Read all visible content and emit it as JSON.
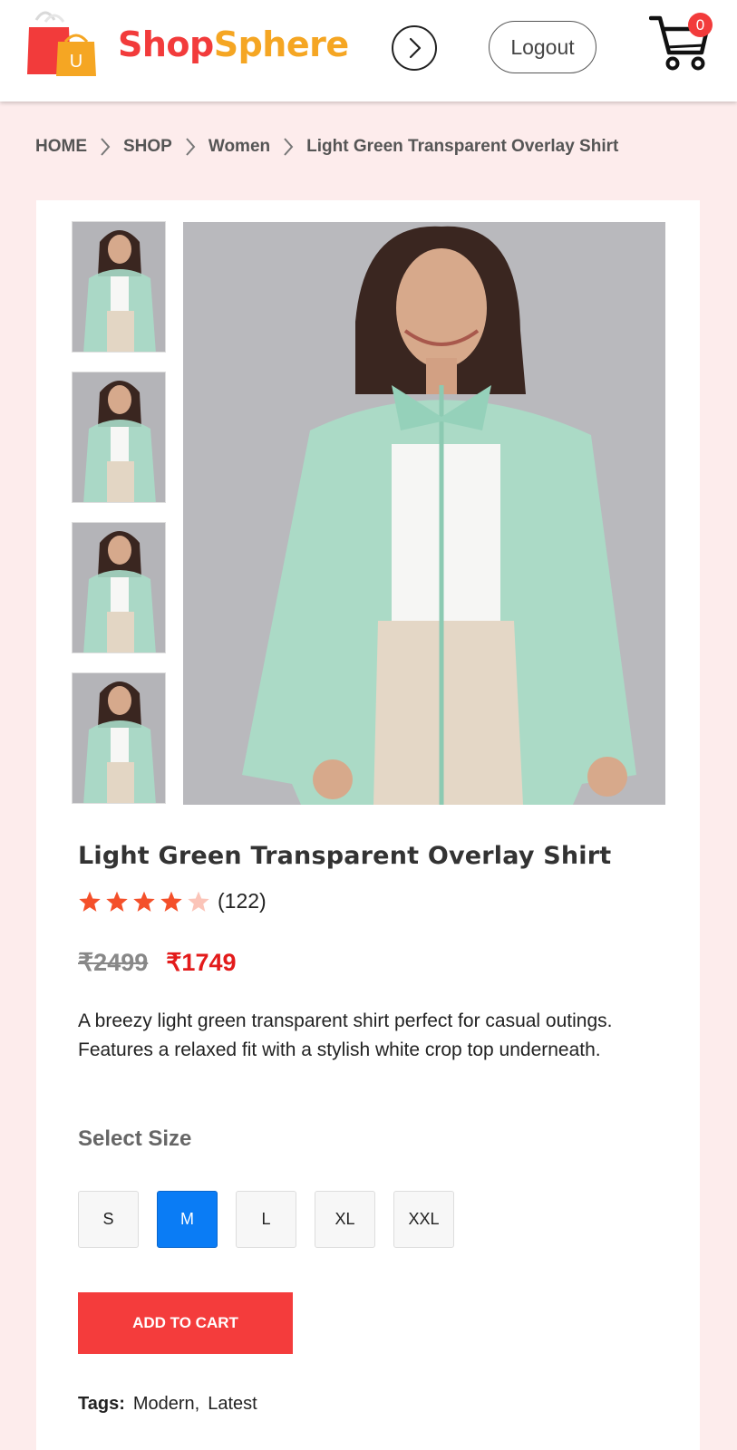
{
  "header": {
    "brand_part1": "Shop",
    "brand_part2": "Sphere",
    "logo_letter": "U",
    "logout_label": "Logout",
    "cart_count": "0",
    "colors": {
      "brand_red": "#f23b3b",
      "brand_orange": "#f5a623"
    },
    "icons": {
      "logo": "shopping-bags-icon",
      "next": "chevron-right-circle-icon",
      "cart": "cart-icon"
    }
  },
  "breadcrumb": {
    "items": [
      "HOME",
      "SHOP",
      "Women",
      "Light Green Transparent Overlay Shirt"
    ],
    "separator_icon": "chevron-right-icon"
  },
  "product": {
    "thumbnail_count": 4,
    "title": "Light Green Transparent Overlay Shirt",
    "rating": 4,
    "rating_max": 5,
    "rating_count": "(122)",
    "old_price": "₹2499",
    "new_price": "₹1749",
    "description": "A breezy light green transparent shirt perfect for casual outings. Features a relaxed fit with a stylish white crop top underneath.",
    "size_label": "Select Size",
    "sizes": [
      "S",
      "M",
      "L",
      "XL",
      "XXL"
    ],
    "selected_size": "M",
    "add_to_cart_label": "ADD TO CART",
    "tags_label": "Tags:",
    "tags": [
      "Modern",
      "Latest"
    ],
    "colors": {
      "price_red": "#e31b1b",
      "selected_blue": "#0a7cf5",
      "add_button": "#f43c3c",
      "star": "#f4502a"
    }
  }
}
